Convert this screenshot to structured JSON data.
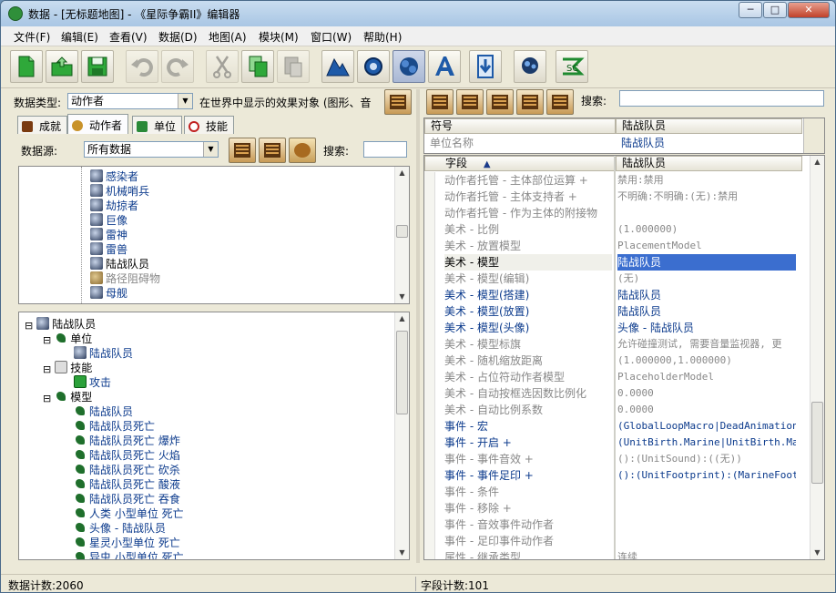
{
  "window": {
    "title": "数据 - [无标题地图] - 《星际争霸II》编辑器",
    "minimize": "─",
    "maximize": "□",
    "close": "✕"
  },
  "menu": [
    "文件(F)",
    "编辑(E)",
    "查看(V)",
    "数据(D)",
    "地图(A)",
    "模块(M)",
    "窗口(W)",
    "帮助(H)"
  ],
  "toolbar": {
    "icons": [
      "new-icon",
      "open-icon",
      "save-icon",
      "undo-icon",
      "redo-icon",
      "cut-icon",
      "copy-icon",
      "paste-icon",
      "terrain-icon",
      "trigger-icon",
      "data-icon",
      "text-icon",
      "import-icon",
      "ai-icon",
      "script-icon"
    ]
  },
  "left": {
    "datatype_label": "数据类型:",
    "datatype_value": "动作者",
    "datatype_desc": "在世界中显示的效果对象 (图形、音",
    "tabs": [
      "成就",
      "动作者",
      "单位",
      "技能"
    ],
    "source_label": "数据源:",
    "source_value": "所有数据",
    "search_label": "搜索:",
    "list": [
      {
        "label": "感染者",
        "style": "link"
      },
      {
        "label": "机械哨兵",
        "style": "link"
      },
      {
        "label": "劫掠者",
        "style": "link"
      },
      {
        "label": "巨像",
        "style": "link"
      },
      {
        "label": "雷神",
        "style": "link"
      },
      {
        "label": "雷兽",
        "style": "link"
      },
      {
        "label": "陆战队员",
        "style": "normal"
      },
      {
        "label": "路径阻碍物",
        "style": "dim"
      },
      {
        "label": "母舰",
        "style": "link"
      }
    ],
    "tree": [
      {
        "label": "陆战队员",
        "level": 0,
        "icon": "unit",
        "exp": "⊟",
        "style": "normal"
      },
      {
        "label": "单位",
        "level": 1,
        "icon": "model",
        "exp": "⊟",
        "style": "normal"
      },
      {
        "label": "陆战队员",
        "level": 2,
        "icon": "unit",
        "exp": "",
        "style": "link"
      },
      {
        "label": "技能",
        "level": 1,
        "icon": "effect",
        "exp": "⊟",
        "style": "normal"
      },
      {
        "label": "攻击",
        "level": 2,
        "icon": "ability",
        "exp": "",
        "style": "link"
      },
      {
        "label": "模型",
        "level": 1,
        "icon": "model",
        "exp": "⊟",
        "style": "normal"
      },
      {
        "label": "陆战队员",
        "level": 2,
        "icon": "model",
        "exp": "",
        "style": "link"
      },
      {
        "label": "陆战队员死亡",
        "level": 2,
        "icon": "model",
        "exp": "",
        "style": "link"
      },
      {
        "label": "陆战队员死亡 爆炸",
        "level": 2,
        "icon": "model",
        "exp": "",
        "style": "link"
      },
      {
        "label": "陆战队员死亡 火焰",
        "level": 2,
        "icon": "model",
        "exp": "",
        "style": "link"
      },
      {
        "label": "陆战队员死亡 砍杀",
        "level": 2,
        "icon": "model",
        "exp": "",
        "style": "link"
      },
      {
        "label": "陆战队员死亡 酸液",
        "level": 2,
        "icon": "model",
        "exp": "",
        "style": "link"
      },
      {
        "label": "陆战队员死亡 吞食",
        "level": 2,
        "icon": "model",
        "exp": "",
        "style": "link"
      },
      {
        "label": "人类 小型单位 死亡",
        "level": 2,
        "icon": "model",
        "exp": "",
        "style": "link"
      },
      {
        "label": "头像 - 陆战队员",
        "level": 2,
        "icon": "model",
        "exp": "",
        "style": "link"
      },
      {
        "label": "星灵小型单位 死亡",
        "level": 2,
        "icon": "model",
        "exp": "",
        "style": "link"
      },
      {
        "label": "异虫 小型单位 死亡",
        "level": 2,
        "icon": "model",
        "exp": "",
        "style": "link"
      }
    ]
  },
  "right": {
    "search_label": "搜索:",
    "top_table": {
      "col1": "符号",
      "col2": "陆战队员",
      "row_name": "单位名称",
      "row_value": "陆战队员"
    },
    "field_header": "字段",
    "value_header": "陆战队员",
    "fields": [
      {
        "name": "动作者托管 - 主体部位运算 +",
        "value": "禁用:禁用",
        "style": "dim"
      },
      {
        "name": "动作者托管 - 主体支持者 +",
        "value": "不明确:不明确:(无):禁用",
        "style": "dim"
      },
      {
        "name": "动作者托管 - 作为主体的附接物",
        "value": "",
        "style": "dim"
      },
      {
        "name": "美术 - 比例",
        "value": "(1.000000)",
        "style": "dim"
      },
      {
        "name": "美术 - 放置模型",
        "value": "PlacementModel",
        "style": "dim"
      },
      {
        "name": "美术 - 模型",
        "value": "陆战队员",
        "style": "selected"
      },
      {
        "name": "美术 - 模型(编辑)",
        "value": "(无)",
        "style": "dim"
      },
      {
        "name": "美术 - 模型(搭建)",
        "value": "陆战队员",
        "style": "link"
      },
      {
        "name": "美术 - 模型(放置)",
        "value": "陆战队员",
        "style": "link"
      },
      {
        "name": "美术 - 模型(头像)",
        "value": "头像 - 陆战队员",
        "style": "link"
      },
      {
        "name": "美术 - 模型标旗",
        "value": "允许碰撞测试, 需要音量监视器, 更",
        "style": "dim"
      },
      {
        "name": "美术 - 随机缩放距离",
        "value": "(1.000000,1.000000)",
        "style": "dim"
      },
      {
        "name": "美术 - 占位符动作者模型",
        "value": "PlaceholderModel",
        "style": "dim"
      },
      {
        "name": "美术 - 自动按框选因数比例化",
        "value": "0.0000",
        "style": "dim"
      },
      {
        "name": "美术 - 自动比例系数",
        "value": "0.0000",
        "style": "dim"
      },
      {
        "name": "事件 - 宏",
        "value": "(GlobalLoopMacro|DeadAnimationMa",
        "style": "link"
      },
      {
        "name": "事件 - 开启 +",
        "value": "(UnitBirth.Marine|UnitBirth.Mari",
        "style": "link"
      },
      {
        "name": "事件 - 事件音效 +",
        "value": "():(UnitSound):((无))",
        "style": "dim"
      },
      {
        "name": "事件 - 事件足印 +",
        "value": "():(UnitFootprint):(MarineFootpr",
        "style": "link"
      },
      {
        "name": "事件 - 条件",
        "value": "",
        "style": "dim"
      },
      {
        "name": "事件 - 移除 +",
        "value": "",
        "style": "dim"
      },
      {
        "name": "事件 - 音效事件动作者",
        "value": "",
        "style": "dim"
      },
      {
        "name": "事件 - 足印事件动作者",
        "value": "",
        "style": "dim"
      },
      {
        "name": "属性 - 继承类型",
        "value": "连续",
        "style": "dim"
      }
    ]
  },
  "status": {
    "left": "数据计数:2060",
    "right": "字段计数:101"
  }
}
